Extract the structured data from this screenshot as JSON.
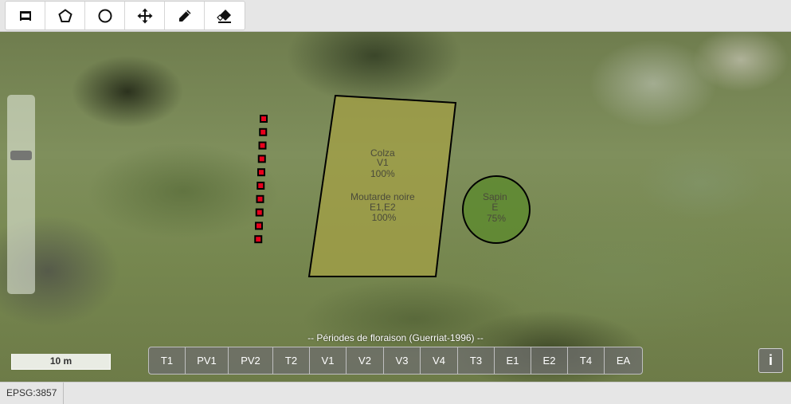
{
  "toolbar": {
    "tools": [
      {
        "icon": "draw-rectangle-icon"
      },
      {
        "icon": "draw-polygon-icon"
      },
      {
        "icon": "draw-circle-icon"
      },
      {
        "icon": "move-icon"
      },
      {
        "icon": "edit-pencil-icon"
      },
      {
        "icon": "eraser-icon"
      }
    ]
  },
  "map": {
    "features": {
      "polygon": {
        "lines": [
          "Colza",
          "V1",
          "100%",
          "",
          "Moutarde noire",
          "E1,E2",
          "100%"
        ],
        "fill": "#a4a045",
        "stroke": "#000000"
      },
      "circle": {
        "lines": [
          "Sapin",
          "E",
          "75%"
        ],
        "fill": "#5e8a30",
        "stroke": "#000000"
      },
      "point_markers": {
        "count": 10,
        "color": "#e8001c"
      }
    },
    "scale_label": "10 m"
  },
  "periods": {
    "title": "-- Périodes de floraison (Guerriat-1996) --",
    "buttons": [
      "T1",
      "PV1",
      "PV2",
      "T2",
      "V1",
      "V2",
      "V3",
      "V4",
      "T3",
      "E1",
      "E2",
      "T4",
      "EA"
    ]
  },
  "info_label": "i",
  "status": {
    "projection": "EPSG:3857"
  }
}
